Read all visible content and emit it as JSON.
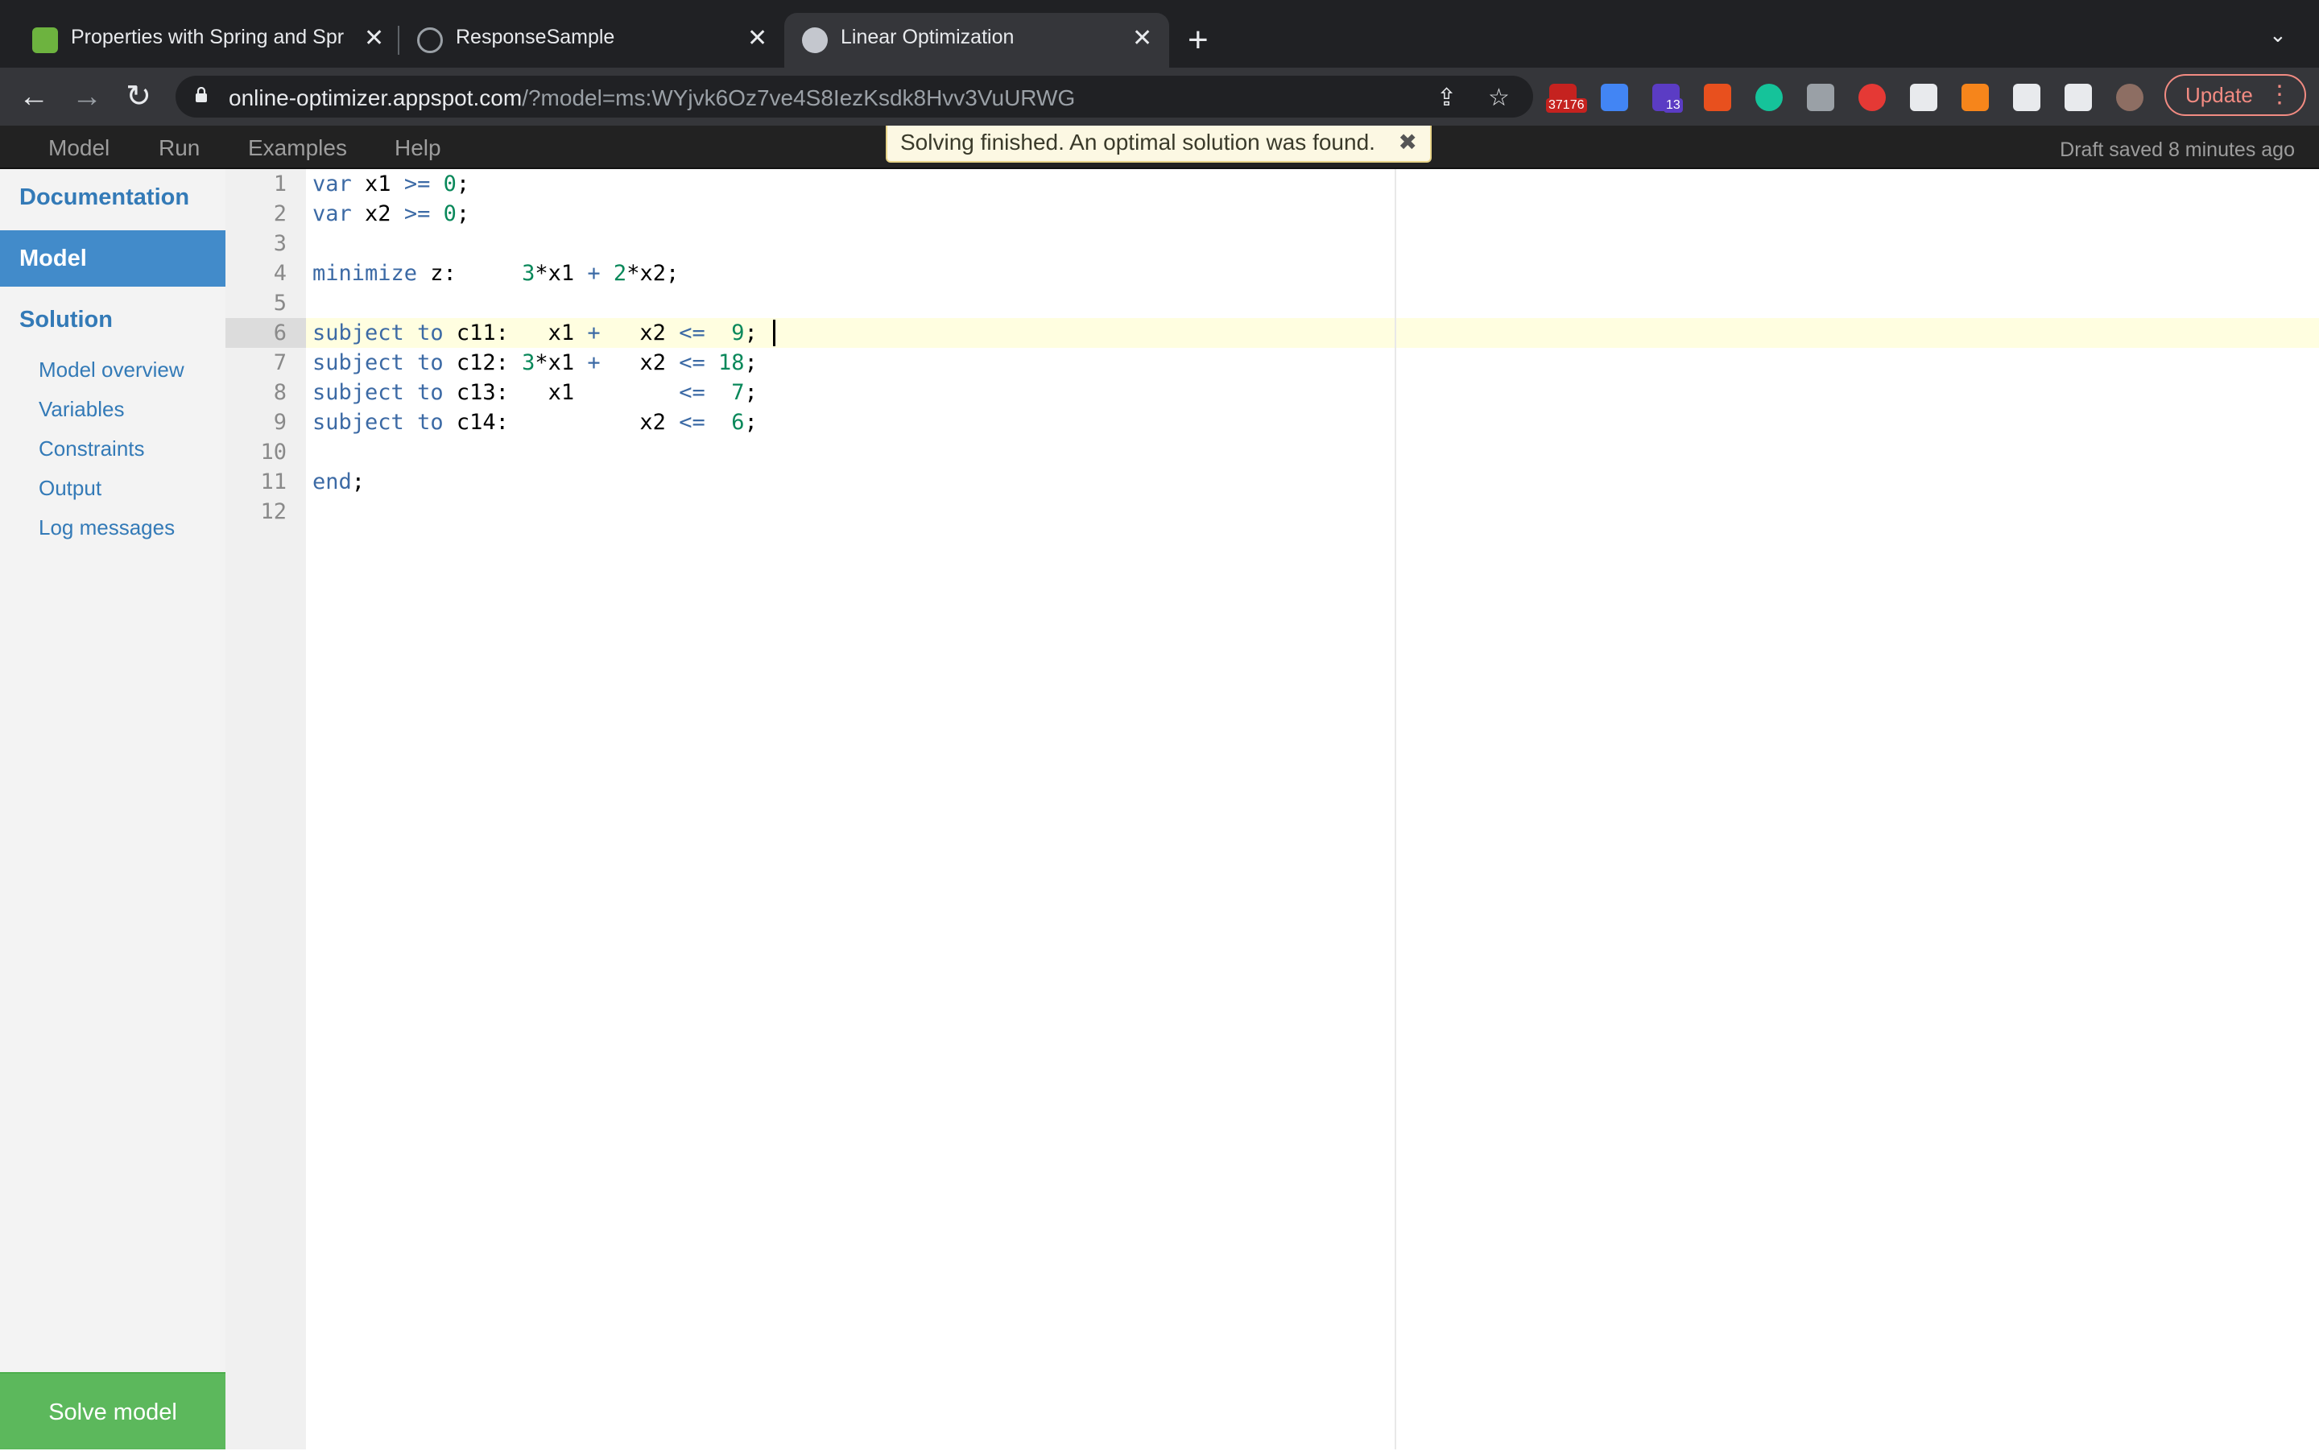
{
  "browser": {
    "tabs": [
      {
        "title": "Properties with Spring and Spr",
        "favicon_color": "#6db33f"
      },
      {
        "title": "ResponseSample",
        "favicon_color": "#9aa0a6"
      },
      {
        "title": "Linear Optimization",
        "favicon_color": "#c4c7ce"
      }
    ],
    "url_host": "online-optimizer.appspot.com",
    "url_path": "/?model=ms:WYjvk6Oz7ve4S8IezKsdk8Hvv3VuURWG",
    "extensions": [
      {
        "name": "gmail-extension-icon",
        "badge": "37176",
        "color": "#c5221f"
      },
      {
        "name": "bookmark-extension-icon",
        "badge": "",
        "color": "#4285f4"
      },
      {
        "name": "purple-extension-icon",
        "badge": "13",
        "color": "#5b3cc4"
      },
      {
        "name": "percent-extension-icon",
        "badge": "",
        "color": "#e8501e"
      },
      {
        "name": "grammarly-icon",
        "badge": "",
        "color": "#15c39a"
      },
      {
        "name": "grey-extension-icon",
        "badge": "",
        "color": "#9aa0a6"
      },
      {
        "name": "speed-extension-icon",
        "badge": "",
        "color": "#e53935"
      },
      {
        "name": "react-devtools-icon",
        "badge": "",
        "color": "#e8eaed"
      },
      {
        "name": "metamask-icon",
        "badge": "",
        "color": "#f6851b"
      },
      {
        "name": "puzzle-extensions-icon",
        "badge": "",
        "color": "#e8eaed"
      },
      {
        "name": "side-panel-icon",
        "badge": "",
        "color": "#e8eaed"
      },
      {
        "name": "profile-avatar",
        "badge": "",
        "color": "#8d6e63"
      }
    ],
    "update_label": "Update"
  },
  "menubar": {
    "items": [
      "Model",
      "Run",
      "Examples",
      "Help"
    ],
    "notification": "Solving finished. An optimal solution was found.",
    "notification_close": "✖",
    "draft_status": "Draft saved 8 minutes ago"
  },
  "sidebar": {
    "documentation": "Documentation",
    "model": "Model",
    "solution": "Solution",
    "solution_items": [
      "Model overview",
      "Variables",
      "Constraints",
      "Output",
      "Log messages"
    ],
    "solve_button": "Solve model"
  },
  "editor": {
    "active_line": 6,
    "lines": [
      "var x1 >= 0;",
      "var x2 >= 0;",
      "",
      "minimize z:     3*x1 + 2*x2;",
      "",
      "subject to c11:   x1 +   x2 <=  9;",
      "subject to c12: 3*x1 +   x2 <= 18;",
      "subject to c13:   x1        <=  7;",
      "subject to c14:          x2 <=  6;",
      "",
      "end;",
      ""
    ]
  }
}
